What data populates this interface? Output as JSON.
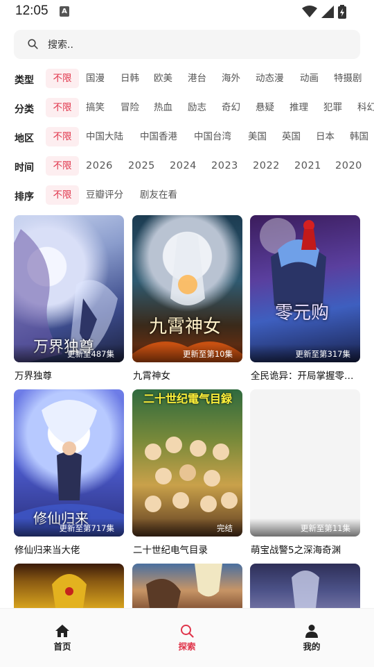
{
  "status": {
    "time": "12:05",
    "notification_letter": "A"
  },
  "search": {
    "placeholder": "搜索.."
  },
  "filters": [
    {
      "label": "类型",
      "items": [
        "不限",
        "国漫",
        "日韩",
        "欧美",
        "港台",
        "海外",
        "动态漫",
        "动画",
        "特摄剧"
      ]
    },
    {
      "label": "分类",
      "items": [
        "不限",
        "搞笑",
        "冒险",
        "热血",
        "励志",
        "奇幻",
        "悬疑",
        "推理",
        "犯罪",
        "科幻"
      ]
    },
    {
      "label": "地区",
      "items": [
        "不限",
        "中国大陆",
        "中国香港",
        "中国台湾",
        "美国",
        "英国",
        "日本",
        "韩国"
      ]
    },
    {
      "label": "时间",
      "items": [
        "不限",
        "2026",
        "2025",
        "2024",
        "2023",
        "2022",
        "2021",
        "2020"
      ]
    },
    {
      "label": "排序",
      "items": [
        "不限",
        "豆瓣评分",
        "剧友在看"
      ]
    }
  ],
  "cards": [
    {
      "title": "万界独尊",
      "badge": "更新至487集",
      "overlay_text": "万界独尊"
    },
    {
      "title": "九霄神女",
      "badge": "更新至第10集",
      "overlay_text": "九霄神女"
    },
    {
      "title": "全民诡异：开局掌握零元购",
      "badge": "更新至第317集",
      "overlay_text": "零元购"
    },
    {
      "title": "修仙归来当大佬",
      "badge": "更新至第717集",
      "overlay_text": "修仙归来"
    },
    {
      "title": "二十世纪电气目录",
      "badge": "完结",
      "overlay_text": "二十世纪電气目録"
    },
    {
      "title": "萌宝战警5之深海奇渊",
      "badge": "更新至第11集",
      "overlay_text": ""
    }
  ],
  "nav": {
    "home": "首页",
    "search": "探索",
    "mine": "我的"
  },
  "colors": {
    "accent": "#e0354b",
    "chip_bg": "#fdeef0"
  }
}
